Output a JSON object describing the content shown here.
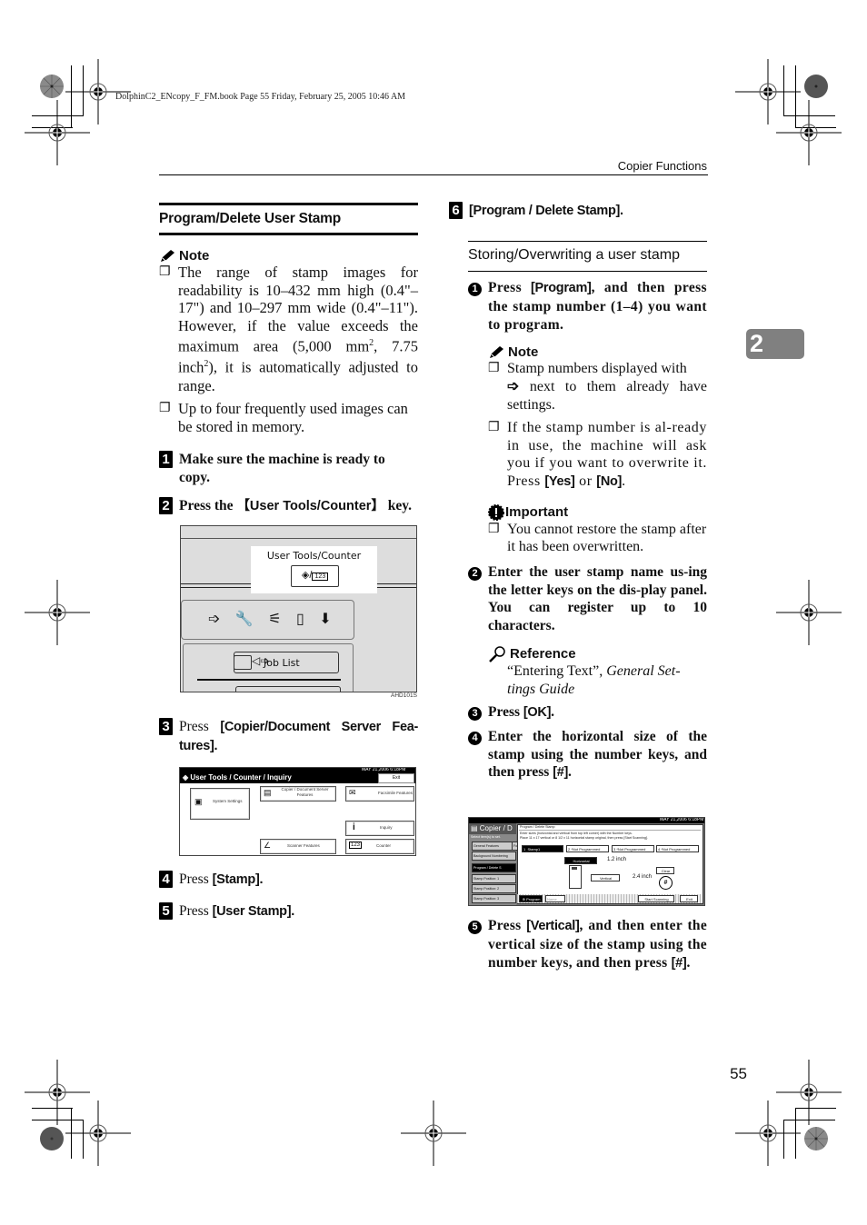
{
  "book_info": "DolphinC2_ENcopy_F_FM.book  Page 55  Friday, February 25, 2005  10:46 AM",
  "running_head": "Copier Functions",
  "chapter_tab": "2",
  "page_number": "55",
  "left": {
    "section_title": "Program/Delete User Stamp",
    "note": {
      "heading": "Note",
      "icon": "pencil-icon",
      "items": [
        {
          "pre": "The range of stamp images for readability is 10–432 mm high (0.4\"–17\") and 10–297 mm wide (0.4\"–11\"). However, if the value exceeds the maximum area (5,000 mm",
          "sup1": "2",
          "mid": ", 7.75 inch",
          "sup2": "2",
          "post": "), it is automatically adjusted to range."
        },
        {
          "text": "Up to four frequently used images can be stored in memory."
        }
      ]
    },
    "steps": [
      {
        "num": "1",
        "text": "Make sure the machine is ready to copy."
      },
      {
        "num": "2",
        "pre": "Press the ",
        "key": "【User Tools/Counter】",
        "post": " key."
      },
      {
        "num": "3",
        "pre": "Press ",
        "key": "[Copier/Document Server Fea-tures]",
        "post": "."
      },
      {
        "num": "4",
        "pre": "Press ",
        "key": "[Stamp]",
        "post": "."
      },
      {
        "num": "5",
        "pre": "Press ",
        "key": "[User Stamp]",
        "post": "."
      }
    ],
    "panel_figure": {
      "label": "User Tools/Counter",
      "job_list": "Job List",
      "figure_id": "AHD101S"
    },
    "screen1": {
      "title": "User Tools / Counter / Inquiry",
      "datetime": "MAY  21,2006  6:18PM",
      "exit": "Exit",
      "buttons": [
        "System Settings",
        "Copier / Document Server Features",
        "Facsimile Features",
        "Inquiry",
        "Scanner Features",
        "Counter"
      ]
    }
  },
  "right": {
    "step6": {
      "num": "6",
      "key": "[Program / Delete Stamp]",
      "post": "."
    },
    "subsection": "Storing/Overwriting a user stamp",
    "substeps": [
      {
        "num": "1",
        "pre": "Press ",
        "key": "[Program]",
        "post": ", and then press the stamp number (1–4) you want to program."
      },
      {
        "num": "2",
        "text": "Enter the user stamp name us-ing the letter keys on the dis-play panel. You can register up to 10 characters."
      },
      {
        "num": "3",
        "pre": "Press ",
        "key": "[OK]",
        "post": "."
      },
      {
        "num": "4",
        "pre": "Enter the horizontal size of the stamp using the number keys, and then press ",
        "key": "[#]",
        "post": "."
      },
      {
        "num": "5",
        "pre": "Press ",
        "key": "[Vertical]",
        "post": ", and then enter the vertical size of the stamp using the number keys, and then press ",
        "key2": "[#]",
        "post2": "."
      }
    ],
    "note": {
      "heading": "Note",
      "items": [
        {
          "pre": "Stamp numbers displayed with",
          "post": " next to them already have settings."
        },
        {
          "pre": "If the stamp number is al-ready in use, the machine will ask you if you want to overwrite it. Press ",
          "k1": "[Yes]",
          "mid": " or ",
          "k2": "[No]",
          "post": "."
        }
      ]
    },
    "important": {
      "heading": "Important",
      "items": [
        "You cannot restore the stamp after it has been overwritten."
      ]
    },
    "reference": {
      "heading": "Reference",
      "text_pre": "“Entering Text”, ",
      "text_italic": "General Set-tings Guide"
    },
    "screen2": {
      "title": "Copier / D",
      "datetime": "MAY  21,2006  6:18PM",
      "side_label": "Select item(s) to set.",
      "side_tabs": [
        "General Features",
        "Fo"
      ],
      "side_items": [
        "Background Numbering",
        "Program / Delete S",
        "Stamp Position:  1",
        "Stamp Position:  2",
        "Stamp Position:  3"
      ],
      "dialog_title": "Program / Delete Stamp",
      "instructions": "Enter sizes (horizontal and vertical from top left corner) with the Number keys.\nPlace 11 x 17 vertical or 8 1/2 x 11 horizontal stamp original, then press [Start Scanning].",
      "stamps": [
        {
          "num": "1",
          "name": "Stamp1"
        },
        {
          "num": "2",
          "name": "*Not Programmed"
        },
        {
          "num": "3",
          "name": "*Not Programmed"
        },
        {
          "num": "4",
          "name": "*Not Programmed"
        }
      ],
      "horizontal": "Horizontal",
      "h_value": "1.2 inch",
      "vertical": "Vertical",
      "v_value": "2.4 inch",
      "clear": "Clear",
      "hash": "#",
      "program": "Program",
      "name_field": "Name",
      "start": "Start Scanning",
      "exit": "Exit"
    }
  }
}
